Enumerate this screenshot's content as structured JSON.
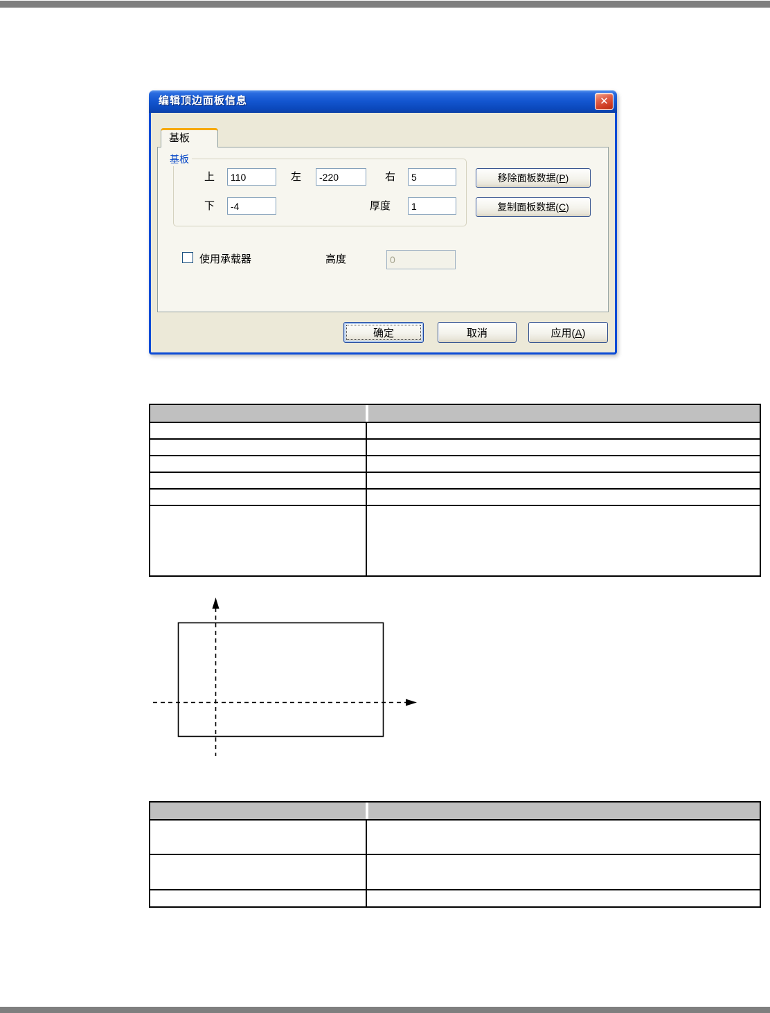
{
  "page": {
    "top_bar_color": "#7f7f7f",
    "bottom_bar_color": "#7f7f7f"
  },
  "dialog": {
    "title": "编辑顶边面板信息",
    "close_glyph": "✕",
    "tab_label": "基板",
    "group_label": "基板",
    "fields": {
      "top": {
        "label": "上",
        "value": "110"
      },
      "left": {
        "label": "左",
        "value": "-220"
      },
      "right": {
        "label": "右",
        "value": "5"
      },
      "bottom": {
        "label": "下",
        "value": "-4"
      },
      "thickness": {
        "label": "厚度",
        "value": "1"
      }
    },
    "remove_button": {
      "text": "移除面板数据(",
      "key": "P",
      "suffix": ")"
    },
    "copy_button": {
      "text": "复制面板数据(",
      "key": "C",
      "suffix": ")"
    },
    "carrier": {
      "checkbox_label": "使用承载器",
      "checkbox_checked": false,
      "height_label": "高度",
      "height_value": "0"
    },
    "footer": {
      "ok": "确定",
      "cancel": "取消",
      "apply_text": "应用(",
      "apply_key": "A",
      "apply_suffix": ")"
    },
    "accent_colors": {
      "titlebar_blue": "#1356D0",
      "frame_blue": "#0B4BD6",
      "tab_orange": "#F7A800",
      "close_red": "#CE3B21",
      "group_label_blue": "#0748C8"
    }
  },
  "tables": {
    "header_fill": "#C0C0C0",
    "table1": {
      "header": [
        "",
        ""
      ],
      "rows": [
        [
          "",
          ""
        ],
        [
          "",
          ""
        ],
        [
          "",
          ""
        ],
        [
          "",
          ""
        ],
        [
          "",
          ""
        ],
        [
          "",
          ""
        ]
      ]
    },
    "table2": {
      "header": [
        "",
        ""
      ],
      "rows": [
        [
          "",
          ""
        ],
        [
          "",
          ""
        ],
        [
          "",
          ""
        ]
      ]
    }
  }
}
